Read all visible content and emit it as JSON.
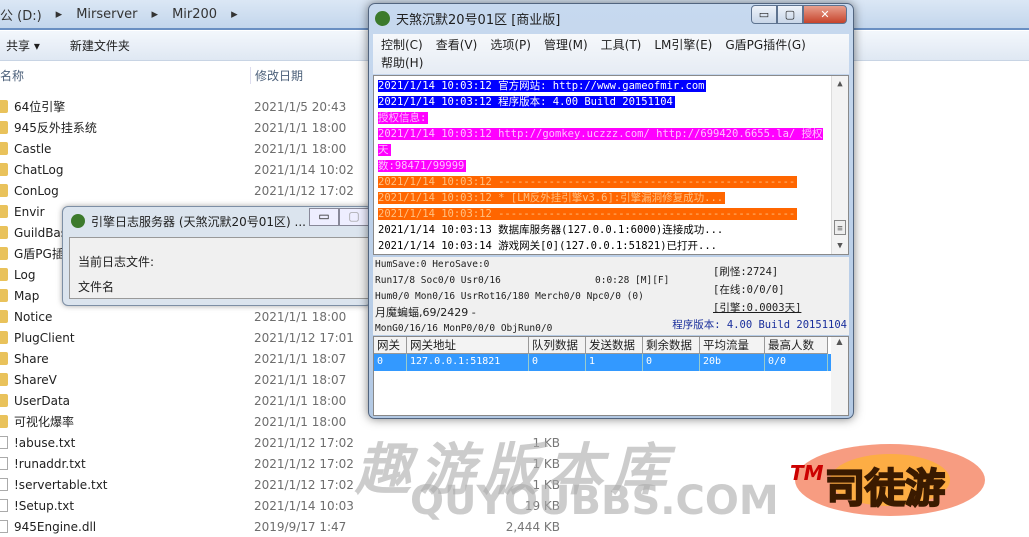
{
  "explorer": {
    "breadcrumb": [
      "公 (D:)",
      "Mirserver",
      "Mir200"
    ],
    "toolbar": {
      "share": "共享 ▾",
      "new_folder": "新建文件夹"
    },
    "columns": {
      "name": "名称",
      "date": "修改日期"
    },
    "files": [
      {
        "name": "64位引擎",
        "date": "2021/1/5 20:43",
        "type": "folder"
      },
      {
        "name": "945反外挂系统",
        "date": "2021/1/1 18:00",
        "type": "folder"
      },
      {
        "name": "Castle",
        "date": "2021/1/1 18:00",
        "type": "folder"
      },
      {
        "name": "ChatLog",
        "date": "2021/1/14 10:02",
        "type": "folder"
      },
      {
        "name": "ConLog",
        "date": "2021/1/12 17:02",
        "type": "folder"
      },
      {
        "name": "Envir",
        "date": "",
        "type": "folder"
      },
      {
        "name": "GuildBase",
        "date": "",
        "type": "folder"
      },
      {
        "name": "G盾PG插件",
        "date": "",
        "type": "folder"
      },
      {
        "name": "Log",
        "date": "",
        "type": "folder"
      },
      {
        "name": "Map",
        "date": "",
        "type": "folder"
      },
      {
        "name": "Notice",
        "date": "2021/1/1 18:00",
        "type": "folder"
      },
      {
        "name": "PlugClient",
        "date": "2021/1/12 17:01",
        "type": "folder"
      },
      {
        "name": "Share",
        "date": "2021/1/1 18:07",
        "type": "folder"
      },
      {
        "name": "ShareV",
        "date": "2021/1/1 18:07",
        "type": "folder"
      },
      {
        "name": "UserData",
        "date": "2021/1/1 18:00",
        "type": "folder"
      },
      {
        "name": "可视化爆率",
        "date": "2021/1/1 18:00",
        "type": "folder"
      },
      {
        "name": "!abuse.txt",
        "date": "2021/1/12 17:02",
        "type": "file",
        "size": "1 KB"
      },
      {
        "name": "!runaddr.txt",
        "date": "2021/1/12 17:02",
        "type": "file",
        "size": "1 KB"
      },
      {
        "name": "!servertable.txt",
        "date": "2021/1/12 17:02",
        "type": "file",
        "size": "1 KB"
      },
      {
        "name": "!Setup.txt",
        "date": "2021/1/14 10:03",
        "type": "file",
        "size": "19 KB"
      },
      {
        "name": "945Engine.dll",
        "date": "2019/9/17 1:47",
        "type": "file",
        "size": "2,444 KB"
      }
    ]
  },
  "log_dialog": {
    "title": "引擎日志服务器 (天煞沉默20号01区) ...",
    "current_file_label": "当前日志文件:",
    "file_name_label": "文件名"
  },
  "main_window": {
    "title": "天煞沉默20号01区 [商业版]",
    "menu": [
      "控制(C)",
      "查看(V)",
      "选项(P)",
      "管理(M)",
      "工具(T)",
      "LM引擎(E)",
      "G盾PG插件(G)",
      "帮助(H)"
    ],
    "log_lines": [
      {
        "text": "2021/1/14 10:03:12 官方网站: http://www.gameofmir.com",
        "bg": "#0000ff",
        "fg": "#ffffff"
      },
      {
        "text": "2021/1/14 10:03:12 程序版本: 4.00 Build 20151104",
        "bg": "#0000ff",
        "fg": "#ffffff"
      },
      {
        "text": "授权信息:",
        "bg": "#ff00ff",
        "fg": "#ffc0ff"
      },
      {
        "text": "2021/1/14 10:03:12 http://gomkey.uczzz.com/ http://699420.6655.la/ 授权天",
        "bg": "#ff00ff",
        "fg": "#ffc0ff"
      },
      {
        "text": "数:98471/99999",
        "bg": "#ff00ff",
        "fg": "#ffc0ff"
      },
      {
        "text": "2021/1/14 10:03:12 -----------------------------------------------",
        "bg": "#ff6600",
        "fg": "#ffc080"
      },
      {
        "text": "2021/1/14 10:03:12 * [LM反外挂引擎v3.6]:引擎漏洞修复成功...",
        "bg": "#ff6600",
        "fg": "#ffc080"
      },
      {
        "text": "2021/1/14 10:03:12 -----------------------------------------------",
        "bg": "#ff6600",
        "fg": "#ffc080"
      },
      {
        "text": "2021/1/14 10:03:13 数据库服务器(127.0.0.1:6000)连接成功...",
        "bg": "",
        "fg": "#000000"
      },
      {
        "text": "2021/1/14 10:03:14 游戏网关[0](127.0.0.1:51821)已打开...",
        "bg": "",
        "fg": "#000000"
      }
    ],
    "status": {
      "line1": "HumSave:0 HeroSave:0",
      "line2": "Run17/8 Soc0/0 Usr0/16",
      "uptime": "0:0:28 [M][F]",
      "line3": "Hum0/0 Mon0/16 UsrRot16/180 Merch0/0 Npc0/0 (0)",
      "line4": "月魔蝙蝠,69/2429 -",
      "line5": "MonG0/16/16 MonP0/0/0 ObjRun0/0",
      "refresh": "[刷怪:2724]",
      "online": "[在线:0/0/0]",
      "engine": "[引擎:0.0003天]",
      "version": "程序版本: 4.00 Build 20151104"
    },
    "gateway_table": {
      "headers": [
        "网关",
        "网关地址",
        "队列数据",
        "发送数据",
        "剩余数据",
        "平均流量",
        "最高人数"
      ],
      "rows": [
        [
          "0",
          "127.0.0.1:51821",
          "0",
          "1",
          "0",
          "20b",
          "0/0"
        ]
      ]
    }
  },
  "watermark": {
    "text": "趣游版本库",
    "sub": "QUYOUBBS.COM",
    "logo": "TM 司徒游"
  },
  "colors": {
    "log_blue": "#0000ff",
    "log_magenta": "#ff00ff",
    "log_orange": "#ff6600",
    "selection": "#3399ff",
    "version_text": "#1a2f9c"
  }
}
